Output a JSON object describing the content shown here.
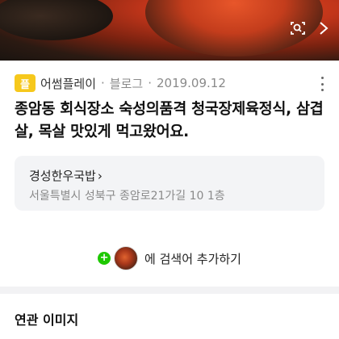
{
  "hero": {
    "icons": [
      "image-search-icon",
      "chevron-right-icon"
    ]
  },
  "meta": {
    "logo_text": "플",
    "blog_name": "어썸플레이",
    "separator": "·",
    "source": "블로그",
    "separator2": "·",
    "date": "2019.09.12"
  },
  "post": {
    "title": "종암동 회식장소 숙성의품격 청국장제육정식, 삼겹살, 목살 맛있게 먹고왔어요."
  },
  "place": {
    "name": "경성한우국밥",
    "arrow": "›",
    "address": "서울특별시 성북구 종암로21가길 10 1층"
  },
  "keyword": {
    "plus": "+",
    "text": "에 검색어 추가하기"
  },
  "related": {
    "title": "연관 이미지"
  },
  "colors": {
    "logo": "#f6c81c",
    "plus": "#1ec800"
  }
}
